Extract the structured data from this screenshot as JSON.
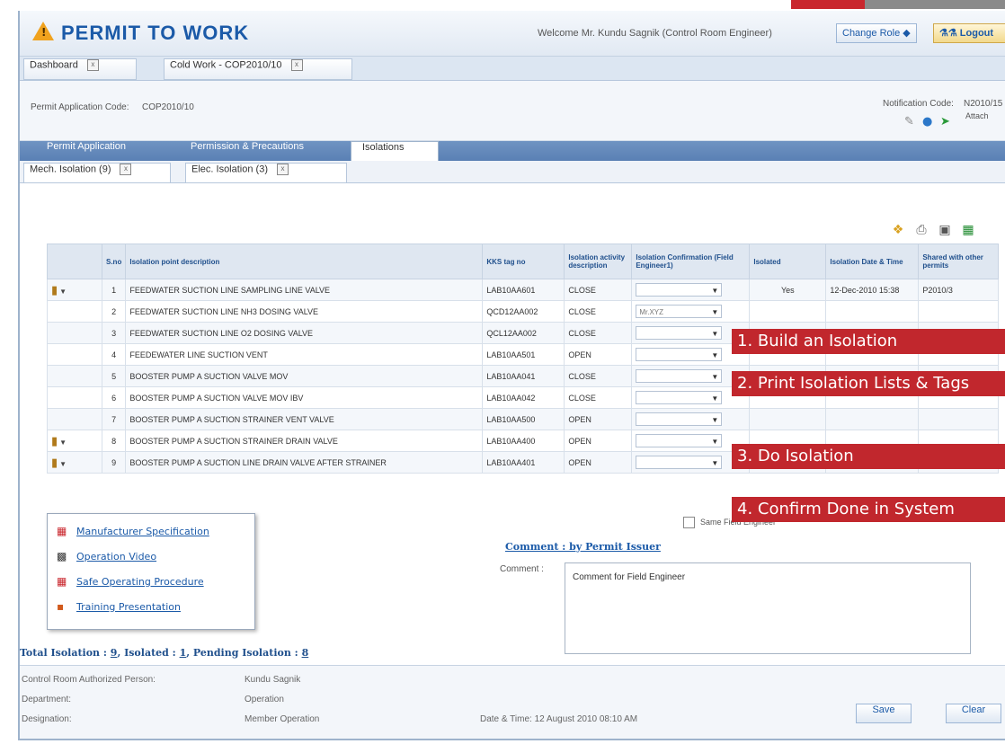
{
  "app": {
    "title": "PERMIT TO WORK",
    "welcome": "Welcome Mr. Kundu Sagnik (Control Room Engineer)",
    "change_role": "Change Role ◆",
    "logout": "Logout"
  },
  "tabs": [
    {
      "label": "Dashboard"
    },
    {
      "label": "Cold Work - COP2010/10"
    }
  ],
  "permit": {
    "code_label": "Permit Application Code:",
    "code_value": "COP2010/10",
    "notification_label": "Notification Code:",
    "notification_value": "N2010/15",
    "attach": "Attach"
  },
  "section_tabs": [
    {
      "label": "Permit Application"
    },
    {
      "label": "Permission & Precautions"
    },
    {
      "label": "Isolations"
    }
  ],
  "isolation_tabs": [
    {
      "label": "Mech. Isolation (9)"
    },
    {
      "label": "Elec. Isolation (3)"
    }
  ],
  "table": {
    "headers": [
      "S.no",
      "Isolation point description",
      "KKS tag no",
      "Isolation activity description",
      "Isolation Confirmation (Field Engineer1)",
      "Isolated",
      "Isolation Date & Time",
      "Shared with other permits"
    ],
    "rows": [
      {
        "sno": "1",
        "desc": "FEEDWATER SUCTION LINE SAMPLING LINE VALVE",
        "kks": "LAB10AA601",
        "activity": "CLOSE",
        "confirm": "",
        "isolated": "Yes",
        "datetime": "12-Dec-2010 15:38",
        "shared": "P2010/3"
      },
      {
        "sno": "2",
        "desc": "FEEDWATER SUCTION LINE NH3 DOSING VALVE",
        "kks": "QCD12AA002",
        "activity": "CLOSE",
        "confirm": "Mr.XYZ",
        "isolated": "",
        "datetime": "",
        "shared": ""
      },
      {
        "sno": "3",
        "desc": "FEEDWATER SUCTION LINE O2 DOSING VALVE",
        "kks": "QCL12AA002",
        "activity": "CLOSE",
        "confirm": "",
        "isolated": "",
        "datetime": "",
        "shared": ""
      },
      {
        "sno": "4",
        "desc": "FEEDEWATER LINE SUCTION VENT",
        "kks": "LAB10AA501",
        "activity": "OPEN",
        "confirm": "",
        "isolated": "",
        "datetime": "",
        "shared": ""
      },
      {
        "sno": "5",
        "desc": "BOOSTER PUMP A SUCTION VALVE MOV",
        "kks": "LAB10AA041",
        "activity": "CLOSE",
        "confirm": "",
        "isolated": "",
        "datetime": "",
        "shared": ""
      },
      {
        "sno": "6",
        "desc": "BOOSTER PUMP A SUCTION VALVE MOV IBV",
        "kks": "LAB10AA042",
        "activity": "CLOSE",
        "confirm": "",
        "isolated": "",
        "datetime": "",
        "shared": ""
      },
      {
        "sno": "7",
        "desc": "BOOSTER PUMP A SUCTION STRAINER VENT VALVE",
        "kks": "LAB10AA500",
        "activity": "OPEN",
        "confirm": "",
        "isolated": "",
        "datetime": "",
        "shared": ""
      },
      {
        "sno": "8",
        "desc": "BOOSTER PUMP A SUCTION STRAINER DRAIN VALVE",
        "kks": "LAB10AA400",
        "activity": "OPEN",
        "confirm": "",
        "isolated": "",
        "datetime": "",
        "shared": ""
      },
      {
        "sno": "9",
        "desc": "BOOSTER PUMP A SUCTION LINE DRAIN VALVE AFTER STRAINER",
        "kks": "LAB10AA401",
        "activity": "OPEN",
        "confirm": "",
        "isolated": "",
        "datetime": "",
        "shared": ""
      }
    ]
  },
  "popup": [
    "Manufacturer Specification",
    "Operation Video",
    "Safe Operating Procedure",
    "Training Presentation"
  ],
  "overlays": [
    "1. Build an Isolation",
    "2. Print Isolation Lists & Tags",
    "3. Do Isolation",
    "4. Confirm Done in System"
  ],
  "same_field_engineer": "Same Field Engineer",
  "comment": {
    "title": "Comment : by Permit Issuer",
    "label": "Comment :",
    "value": "Comment for Field Engineer"
  },
  "totals": {
    "prefix": "Total Isolation : ",
    "total": "9",
    "mid": ", Isolated : ",
    "isolated": "1",
    "mid2": ", Pending Isolation : ",
    "pending": "8"
  },
  "footer": {
    "person_label": "Control Room Authorized Person:",
    "person_value": "Kundu Sagnik",
    "dept_label": "Department:",
    "dept_value": "Operation",
    "desig_label": "Designation:",
    "desig_value": "Member Operation",
    "datetime": "Date & Time: 12 August 2010 08:10 AM",
    "save": "Save",
    "clear": "Clear"
  },
  "colors": {
    "accent_blue": "#1b5aa8",
    "overlay_red": "#c1272d",
    "tab_blue": "#5a80b4"
  }
}
